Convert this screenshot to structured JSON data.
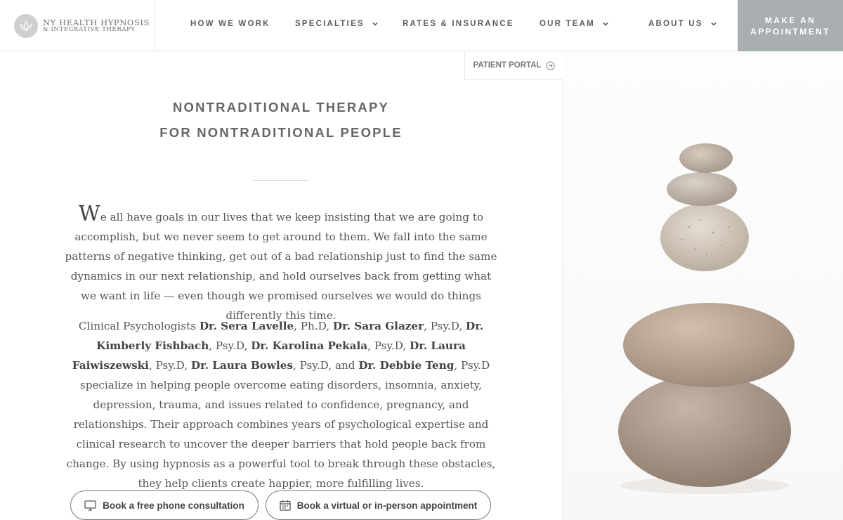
{
  "logo": {
    "line1": "NY HEALTH HYPNOSIS",
    "line2": "& INTEGRATIVE THERAPY"
  },
  "nav": {
    "items": [
      {
        "label": "HOW WE WORK"
      },
      {
        "label": "SPECIALTIES"
      },
      {
        "label": "RATES & INSURANCE"
      },
      {
        "label": "OUR TEAM"
      },
      {
        "label": "ABOUT US"
      }
    ],
    "cta_line1": "MAKE AN",
    "cta_line2": "APPOINTMENT"
  },
  "portal": {
    "label": "PATIENT PORTAL"
  },
  "hero": {
    "title_line1": "NONTRADITIONAL THERAPY",
    "title_line2": "FOR NONTRADITIONAL PEOPLE"
  },
  "intro": {
    "dropcap": "W",
    "text": "e all have goals in our lives that we keep insisting that we are going to accomplish, but we never seem to get around to them. We fall into the same patterns of negative thinking, get out of a bad relationship just to find the same dynamics in our next relationship, and hold ourselves back from getting what we want in life — even though we promised ourselves we would do things differently this time."
  },
  "team_para": {
    "t0": "Clinical Psychologists ",
    "n1": "Dr. Sera Lavelle",
    "t1": ", Ph.D, ",
    "n2": "Dr. Sara Glazer",
    "t2": ", Psy.D, ",
    "n3": "Dr. Kimberly Fishbach",
    "t3": ", Psy.D, ",
    "n4": "Dr. Karolina Pekala",
    "t4": ", Psy.D, ",
    "n5": "Dr. Laura Faiwiszewski",
    "t5": ", Psy.D, ",
    "n6": "Dr. Laura Bowles",
    "t6": ", Psy.D, and ",
    "n7": "Dr. Debbie Teng",
    "t7": ", Psy.D specialize in helping people overcome eating disorders, insomnia, anxiety, depression, trauma, and issues related to confidence, pregnancy, and relationships. Their approach combines years of psychological expertise and clinical research to uncover the deeper barriers that hold people back from change. By using hypnosis as a powerful tool to break through these obstacles, they help clients create happier, more fulfilling lives."
  },
  "buttons": {
    "phone": "Book a free phone consultation",
    "appointment": "Book a virtual or in-person appointment"
  },
  "colors": {
    "cta_bg": "#a9aeb0",
    "text": "#555555"
  }
}
